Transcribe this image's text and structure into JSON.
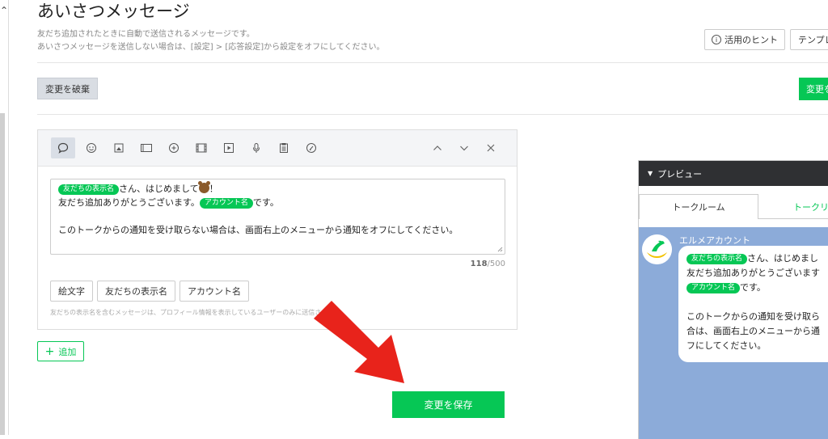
{
  "page": {
    "title": "あいさつメッセージ",
    "desc_line1": "友だち追加されたときに自動で送信されるメッセージです。",
    "desc_line2": "あいさつメッセージを送信しない場合は、[設定] > [応答設定]から設定をオフにしてください。"
  },
  "header_buttons": {
    "hint": "活用のヒント",
    "template": "テンプレ"
  },
  "actions": {
    "discard": "変更を破棄",
    "save_top": "変更を",
    "save_main": "変更を保存",
    "add": "追加"
  },
  "toolbar": {
    "tools": [
      "text-icon",
      "emoji-icon",
      "sticker-icon",
      "image-icon",
      "coupon-icon",
      "video-icon",
      "play-icon",
      "mic-icon",
      "richmessage-icon",
      "survey-icon"
    ],
    "controls": [
      "chevron-up-icon",
      "chevron-down-icon",
      "close-icon"
    ]
  },
  "message": {
    "chip_name": "友だちの表示名",
    "line1_text": "さん、はじめまして",
    "line1_end": "！",
    "line2_start": "友だち追加ありがとうございます。",
    "chip_account": "アカウント名",
    "line2_end": "です。",
    "line4": "このトークからの通知を受け取らない場合は、画面右上のメニューから通知をオフにしてください。",
    "count": "118",
    "max": "/500"
  },
  "insert_buttons": {
    "emoji": "絵文字",
    "friend_name": "友だちの表示名",
    "account_name": "アカウント名"
  },
  "note": "友だちの表示名を含むメッセージは、プロフィール情報を表示しているユーザーのみに送信されます。",
  "preview": {
    "header": "プレビュー",
    "tab_active": "トークルーム",
    "tab_other": "トークリ",
    "account": "エルメアカウント",
    "chip_name": "友だちの表示名",
    "line1": "さん、はじめまし",
    "line2": "友だち追加ありがとうございます",
    "chip_account": "アカウント名",
    "line3": "です。",
    "line5": "このトークからの通知を受け取ら",
    "line6": "合は、画面右上のメニューから通",
    "line7": "フにしてください。"
  },
  "colors": {
    "accent": "#06c755",
    "arrow": "#e8231b",
    "preview_chat_bg": "#8cabd9"
  }
}
